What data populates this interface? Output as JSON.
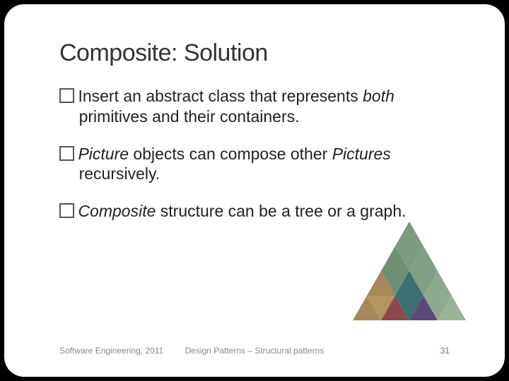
{
  "title": "Composite: Solution",
  "bullets": [
    {
      "pre": "Insert an abstract class that represents ",
      "em": "both",
      "post": " primitives and their containers."
    },
    {
      "em_first": "Picture",
      "mid": " objects can compose other ",
      "em_second": "Pictures",
      "post": " recursively."
    },
    {
      "em_first": "Composite",
      "post": " structure can be a tree or a graph."
    }
  ],
  "footer": {
    "left": "Software Engineering, 2011",
    "center": "Design Patterns – Structural patterns",
    "right": "31"
  }
}
